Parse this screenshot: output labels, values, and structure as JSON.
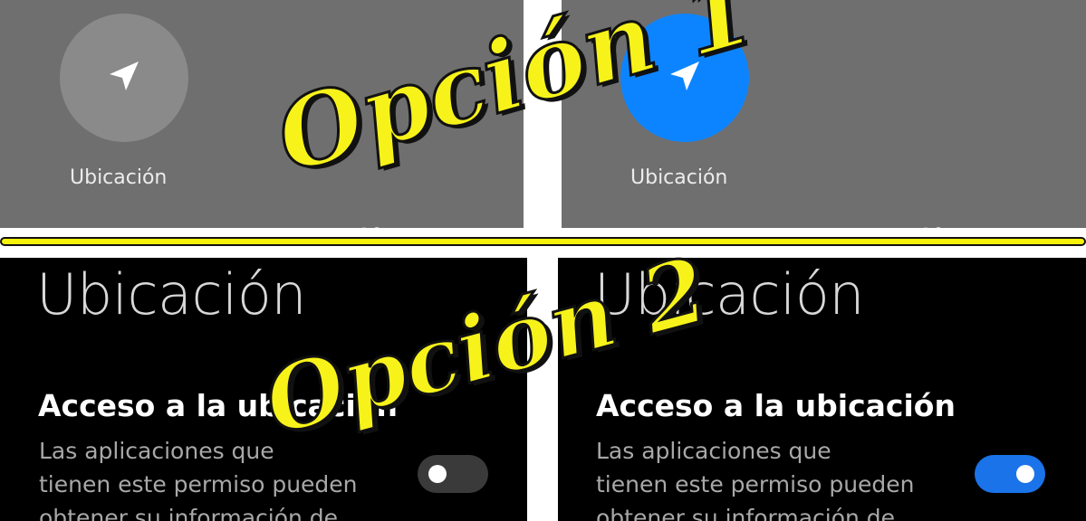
{
  "option1": {
    "overlay_label": "Opción 1",
    "off_tile": {
      "icon": "location-arrow-icon",
      "label": "Ubicación",
      "color": "#8a8a8a"
    },
    "on_tile": {
      "icon": "location-arrow-icon",
      "label": "Ubicación",
      "color": "#0d84ff"
    },
    "panel_color": "#6f6f6f"
  },
  "option2": {
    "overlay_label": "Opción 2",
    "left": {
      "title": "Ubicación",
      "section_title": "Acceso a la ubicación",
      "description_lines": [
        "Las aplicaciones que",
        "tienen este permiso pueden",
        "obtener su información de"
      ],
      "toggle_state": "off"
    },
    "right": {
      "title": "Ubicación",
      "section_title": "Acceso a la ubicación",
      "description_lines": [
        "Las aplicaciones que",
        "tienen este permiso pueden",
        "obtener su información de"
      ],
      "toggle_state": "on"
    },
    "toggle_on_color": "#1a73e8",
    "toggle_off_color": "#3a3a3a"
  },
  "overlay_color": "#f7f31a"
}
